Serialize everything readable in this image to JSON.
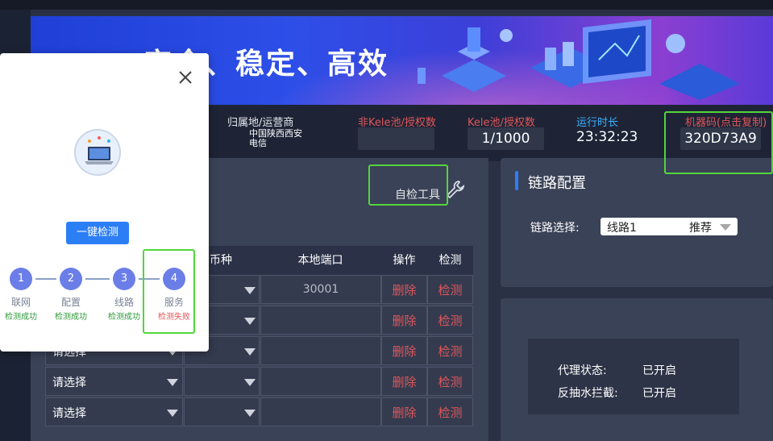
{
  "banner": {
    "slogan": "安全、稳定、高效"
  },
  "infobar": {
    "location_label": "归属地/运营商",
    "location_value": "中国陕西西安\n电信",
    "non_kele_label": "非Kele池/授权数",
    "kele_label": "Kele池/授权数",
    "kele_value": "1/1000",
    "uptime_label": "运行时长",
    "uptime_value": "23:32:23",
    "machine_label": "机器码(点击复制)",
    "machine_value": "320D73A9"
  },
  "toolbar": {
    "self_check_label": "自检工具"
  },
  "table": {
    "headers": {
      "coin": "币种",
      "port": "本地端口",
      "op": "操作",
      "check": "检测"
    },
    "select_placeholder": "请选择",
    "rows": [
      {
        "port": "30001",
        "delete": "删除",
        "check": "检测"
      },
      {
        "port": "",
        "delete": "删除",
        "check": "检测"
      },
      {
        "port": "",
        "delete": "删除",
        "check": "检测"
      },
      {
        "port": "",
        "delete": "删除",
        "check": "检测"
      },
      {
        "port": "",
        "delete": "删除",
        "check": "检测"
      }
    ]
  },
  "link_config": {
    "title": "链路配置",
    "select_label": "链路选择:",
    "select_value": "线路1",
    "select_tag": "推荐"
  },
  "status": {
    "proxy_label": "代理状态:",
    "proxy_value": "已开启",
    "anti_label": "反抽水拦截:",
    "anti_value": "已开启"
  },
  "modal": {
    "button_label": "一键检测",
    "steps": [
      {
        "num": "1",
        "label": "联网",
        "state": "检测成功",
        "ok": true
      },
      {
        "num": "2",
        "label": "配置",
        "state": "检测成功",
        "ok": true
      },
      {
        "num": "3",
        "label": "线路",
        "state": "检测成功",
        "ok": true
      },
      {
        "num": "4",
        "label": "服务",
        "state": "检测失败",
        "ok": false
      }
    ]
  },
  "colors": {
    "accent": "#2c7ef5",
    "danger": "#e0565a",
    "highlight": "#53d63a",
    "success": "#2d9a3a"
  }
}
